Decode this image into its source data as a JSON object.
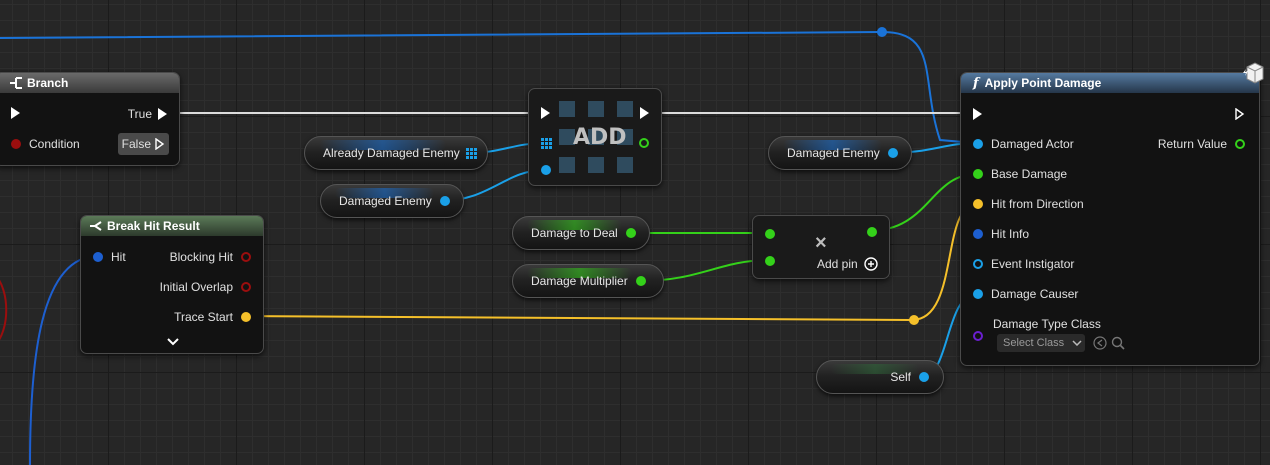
{
  "branch": {
    "title": "Branch",
    "true_label": "True",
    "condition_label": "Condition",
    "false_label": "False"
  },
  "break_hit_result": {
    "title": "Break Hit Result",
    "hit_label": "Hit",
    "blocking_hit_label": "Blocking Hit",
    "initial_overlap_label": "Initial Overlap",
    "trace_start_label": "Trace Start"
  },
  "variables": {
    "already_damaged_enemy": "Already Damaged Enemy",
    "damaged_enemy_1": "Damaged Enemy",
    "damaged_enemy_2": "Damaged Enemy",
    "damage_to_deal": "Damage to Deal",
    "damage_multiplier": "Damage Multiplier",
    "self": "Self"
  },
  "add_node": {
    "title": "ADD"
  },
  "multiply_node": {
    "symbol": "×",
    "add_pin_label": "Add pin"
  },
  "apply_point_damage": {
    "title": "Apply Point Damage",
    "function_symbol": "f",
    "damaged_actor_label": "Damaged Actor",
    "return_value_label": "Return Value",
    "base_damage_label": "Base Damage",
    "hit_from_direction_label": "Hit from Direction",
    "hit_info_label": "Hit Info",
    "event_instigator_label": "Event Instigator",
    "damage_causer_label": "Damage Causer",
    "damage_type_class_label": "Damage Type Class",
    "select_class_value": "Select Class"
  },
  "colors": {
    "object_pin": "#1aa0e8",
    "float_pin": "#34d11a",
    "vector_pin": "#f5c02a",
    "struct_pin": "#1d5fd0",
    "bool_pin": "#9b0e0e",
    "class_pin": "#6a1fd0",
    "exec_pin": "#ffffff"
  },
  "icons": [
    "branch-icon",
    "break-struct-icon",
    "function-icon",
    "array-grid-icon",
    "add-pin-icon",
    "chevron-down-icon",
    "dropdown-arrow-icon",
    "use-selected-icon",
    "browse-icon",
    "latent-clock-icon"
  ]
}
